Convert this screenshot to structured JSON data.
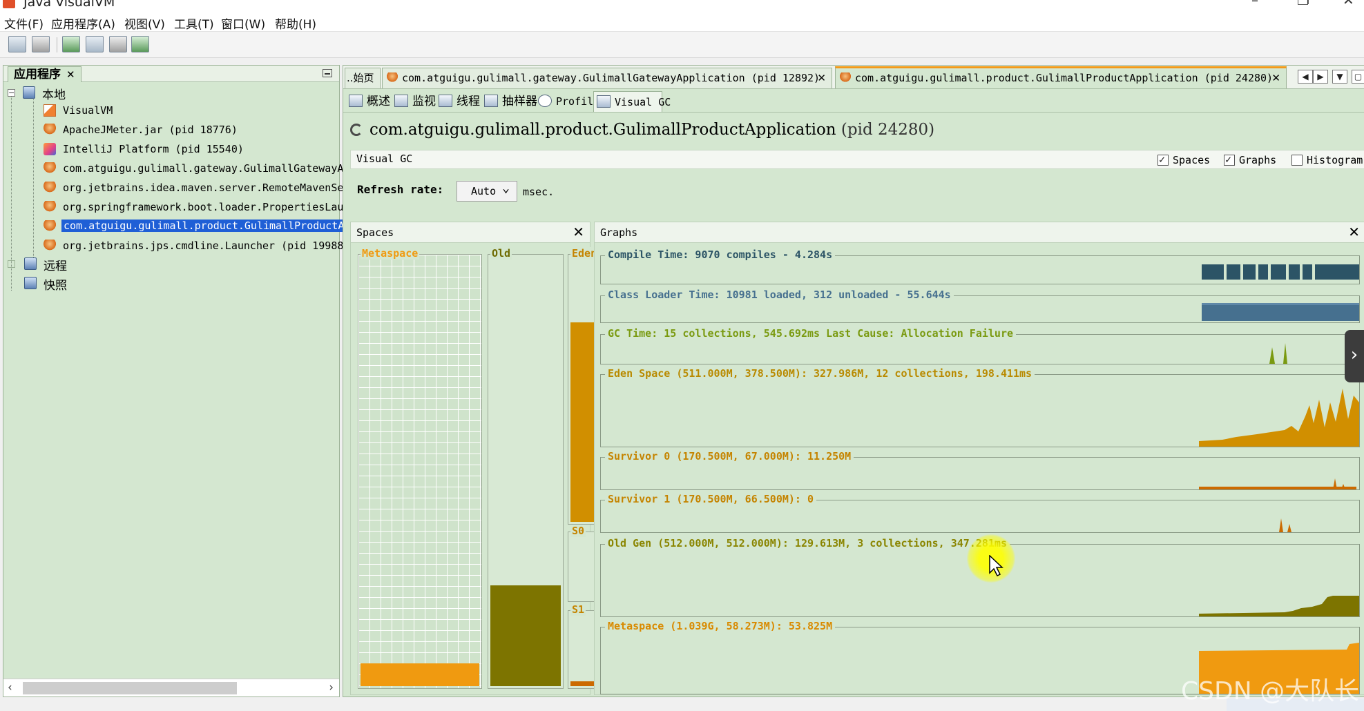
{
  "window": {
    "title": "Java VisualVM"
  },
  "menu": [
    "文件(F)",
    "应用程序(A)",
    "视图(V)",
    "工具(T)",
    "窗口(W)",
    "帮助(H)"
  ],
  "left_panel": {
    "tab_label": "应用程序",
    "tree": {
      "local_label": "本地",
      "remote_label": "远程",
      "snapshots_label": "快照",
      "items": [
        {
          "label": "VisualVM",
          "icon": "visualvm-icon"
        },
        {
          "label": "ApacheJMeter.jar (pid 18776)",
          "icon": "java-app-icon"
        },
        {
          "label": "IntelliJ Platform (pid 15540)",
          "icon": "intellij-icon"
        },
        {
          "label": "com.atguigu.gulimall.gateway.GulimallGatewayAp",
          "icon": "java-app-icon"
        },
        {
          "label": "org.jetbrains.idea.maven.server.RemoteMavenSer",
          "icon": "java-app-icon"
        },
        {
          "label": "org.springframework.boot.loader.PropertiesLaun",
          "icon": "java-app-icon"
        },
        {
          "label": "com.atguigu.gulimall.product.GulimallProductAp",
          "icon": "java-app-icon",
          "selected": true
        },
        {
          "label": "org.jetbrains.jps.cmdline.Launcher (pid 19988)",
          "icon": "java-app-icon"
        }
      ]
    }
  },
  "doc_tabs": {
    "home": "..始页",
    "gateway": "com.atguigu.gulimall.gateway.GulimallGatewayApplication (pid 12892)",
    "product": "com.atguigu.gulimall.product.GulimallProductApplication (pid 24280)"
  },
  "sub_tabs": [
    "概述",
    "监视",
    "线程",
    "抽样器",
    "Profiler",
    "Visual GC"
  ],
  "app": {
    "name": "com.atguigu.gulimall.product.GulimallProductApplication",
    "pid": "(pid 24280)"
  },
  "visual_gc": {
    "header_label": "Visual GC",
    "options": [
      {
        "label": "Spaces",
        "checked": true
      },
      {
        "label": "Graphs",
        "checked": true
      },
      {
        "label": "Histogram",
        "checked": false
      }
    ],
    "refresh_label": "Refresh rate:",
    "refresh_value": "Auto",
    "refresh_unit": "msec."
  },
  "spaces": {
    "title": "Spaces",
    "metaspace_label": "Metaspace",
    "old_label": "Old",
    "eden_label": "Eden",
    "s0_label": "S0",
    "s1_label": "S1",
    "metaspace_fill": 0.052,
    "old_fill": 0.233,
    "eden_fill": 0.742,
    "s0_fill": 0.0,
    "s1_fill": 0.066
  },
  "graphs": {
    "title": "Graphs",
    "compile": "Compile Time: 9070 compiles - 4.284s",
    "classloader": "Class Loader Time: 10981 loaded, 312 unloaded - 55.644s",
    "gc": "GC Time: 15 collections, 545.692ms Last Cause: Allocation Failure",
    "eden": "Eden Space (511.000M, 378.500M): 327.986M, 12 collections, 198.411ms",
    "survivor0": "Survivor 0 (170.500M, 67.000M): 11.250M",
    "survivor1": "Survivor 1 (170.500M, 66.500M): 0",
    "oldgen": "Old Gen (512.000M, 512.000M): 129.613M, 3 collections, 347.281ms",
    "metaspace": "Metaspace (1.039G, 58.273M): 53.825M"
  },
  "colors": {
    "panel_bg": "#d4e7d0",
    "eden": "#d18f00",
    "old": "#7d7400",
    "metaspace": "#f09a10",
    "survivor": "#cc6a00",
    "compile": "#2c5466",
    "classloader": "#46708f",
    "gc_title": "#7a9a10",
    "eden_title": "#b98a00",
    "oldgen_title": "#8a8500",
    "selection": "#1f5fd6"
  },
  "watermark": "CSDN @大队长"
}
